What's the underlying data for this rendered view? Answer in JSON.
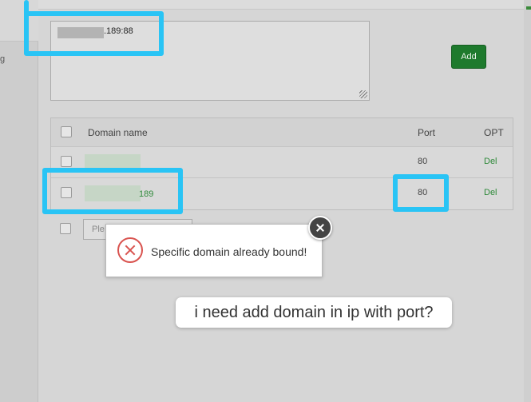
{
  "background": {
    "left_text": "g"
  },
  "form": {
    "domain_value": ".189:88",
    "add_label": "Add"
  },
  "table": {
    "headers": {
      "domain": "Domain name",
      "port": "Port",
      "opt": "OPT"
    },
    "rows": [
      {
        "domain_suffix": "",
        "port": "80",
        "opt": "Del"
      },
      {
        "domain_suffix": "189",
        "port": "80",
        "opt": "Del"
      }
    ],
    "new_row_placeholder": "Ple"
  },
  "toast": {
    "message": "Specific domain already bound!"
  },
  "annotation": {
    "question": "i need add domain in ip with port?"
  },
  "colors": {
    "highlight": "#29c4f5",
    "add_button": "#1e7a2d",
    "link_green": "#2f8a3a",
    "error_red": "#d9534f"
  },
  "icons": {
    "error": "error-circle-x-icon",
    "close": "close-icon",
    "resize": "resize-grip-icon"
  }
}
